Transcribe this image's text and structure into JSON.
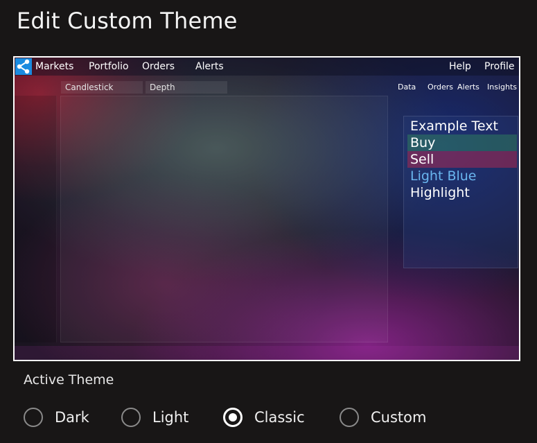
{
  "page": {
    "title": "Edit Custom Theme"
  },
  "preview": {
    "navbar": {
      "logo_icon": "network-share-icon",
      "items": [
        "Markets",
        "Portfolio",
        "Orders",
        "Alerts"
      ],
      "right_items": [
        "Help",
        "Profile"
      ]
    },
    "subtabs": [
      "Candlestick",
      "Depth"
    ],
    "subnav_right": [
      "Data",
      "Orders",
      "Alerts",
      "Insights"
    ],
    "legend": {
      "example_text": "Example Text",
      "buy": "Buy",
      "sell": "Sell",
      "light_blue": "Light Blue",
      "highlight": "Highlight"
    },
    "colors": {
      "buy": "#328c5a",
      "sell": "#aa2850",
      "light_blue": "#6ab6ef",
      "logo": "#1a8be0"
    }
  },
  "theme_selector": {
    "label": "Active Theme",
    "options": [
      {
        "label": "Dark",
        "checked": false
      },
      {
        "label": "Light",
        "checked": false
      },
      {
        "label": "Classic",
        "checked": true
      },
      {
        "label": "Custom",
        "checked": false
      }
    ]
  }
}
